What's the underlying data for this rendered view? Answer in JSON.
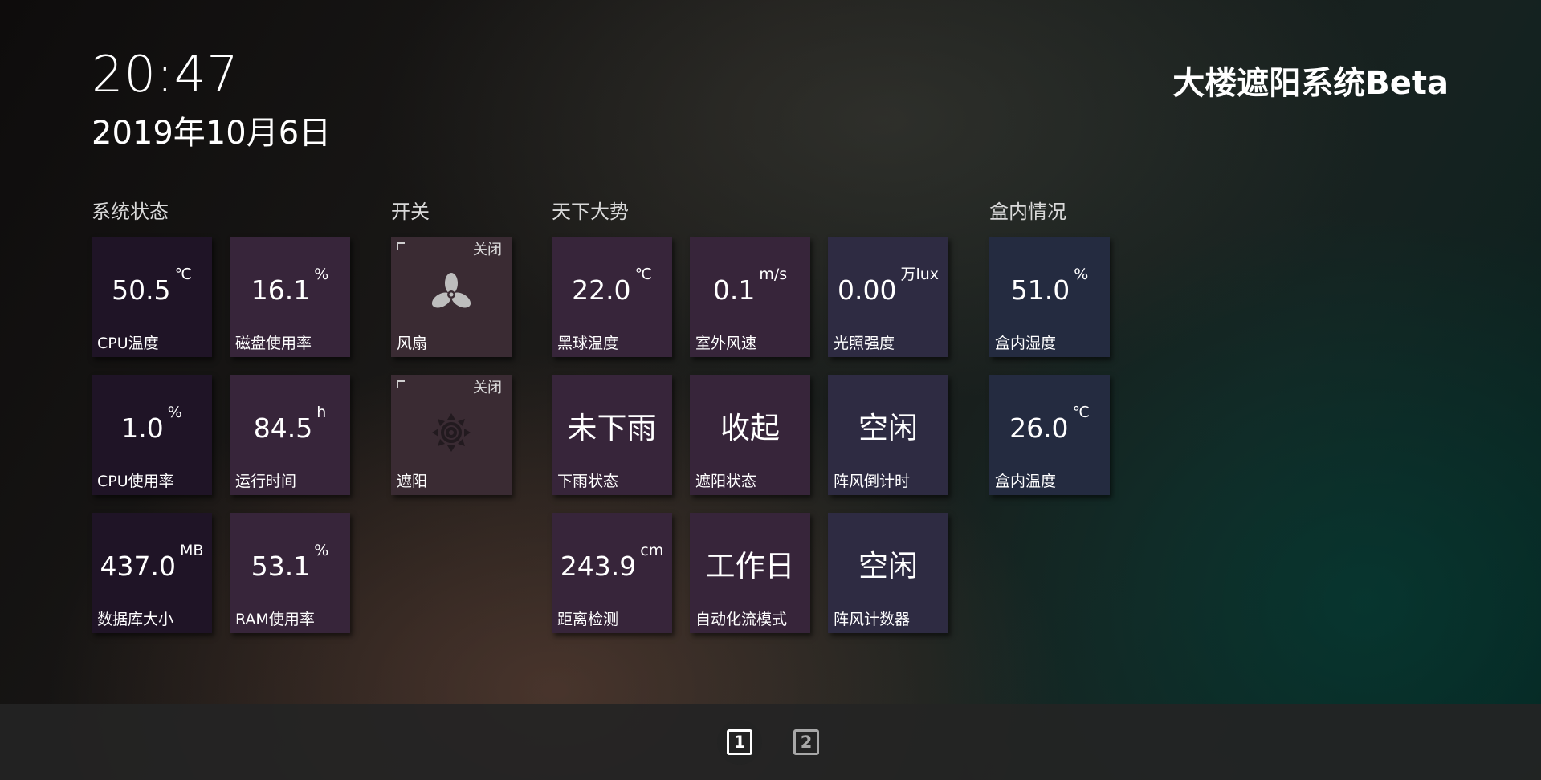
{
  "header": {
    "time": "20:47",
    "date": "2019年10月6日",
    "title": "大楼遮阳系统Beta"
  },
  "groups": {
    "system": "系统状态",
    "switches": "开关",
    "weather": "天下大势",
    "box": "盒内情况"
  },
  "system_status": [
    {
      "value": "50.5",
      "unit": "℃",
      "label": "CPU温度"
    },
    {
      "value": "16.1",
      "unit": "%",
      "label": "磁盘使用率"
    },
    {
      "value": "1.0",
      "unit": "%",
      "label": "CPU使用率"
    },
    {
      "value": "84.5",
      "unit": "h",
      "label": "运行时间"
    },
    {
      "value": "437.0",
      "unit": "MB",
      "label": "数据库大小"
    },
    {
      "value": "53.1",
      "unit": "%",
      "label": "RAM使用率"
    }
  ],
  "switches": [
    {
      "state": "关闭",
      "label": "风扇",
      "icon": "fan-icon"
    },
    {
      "state": "关闭",
      "label": "遮阳",
      "icon": "sun-icon"
    }
  ],
  "weather": [
    {
      "value": "22.0",
      "unit": "℃",
      "label": "黑球温度"
    },
    {
      "value": "0.1",
      "unit": "m/s",
      "label": "室外风速"
    },
    {
      "value": "0.00",
      "unit": "万lux",
      "label": "光照强度"
    },
    {
      "text": "未下雨",
      "label": "下雨状态"
    },
    {
      "text": "收起",
      "label": "遮阳状态"
    },
    {
      "text": "空闲",
      "label": "阵风倒计时"
    },
    {
      "value": "243.9",
      "unit": "cm",
      "label": "距离检测"
    },
    {
      "text": "工作日",
      "label": "自动化流模式"
    },
    {
      "text": "空闲",
      "label": "阵风计数器"
    }
  ],
  "box_status": [
    {
      "value": "51.0",
      "unit": "%",
      "label": "盒内湿度"
    },
    {
      "value": "26.0",
      "unit": "℃",
      "label": "盒内温度"
    }
  ],
  "footer": {
    "pages": [
      "1",
      "2"
    ],
    "active_page": "1"
  },
  "colors": {
    "tile_purple": "#1f1426",
    "tile_mauve": "#37253a",
    "tile_slate": "#2e2b42",
    "tile_navy": "#242b40",
    "footer_bg": "#242424"
  }
}
